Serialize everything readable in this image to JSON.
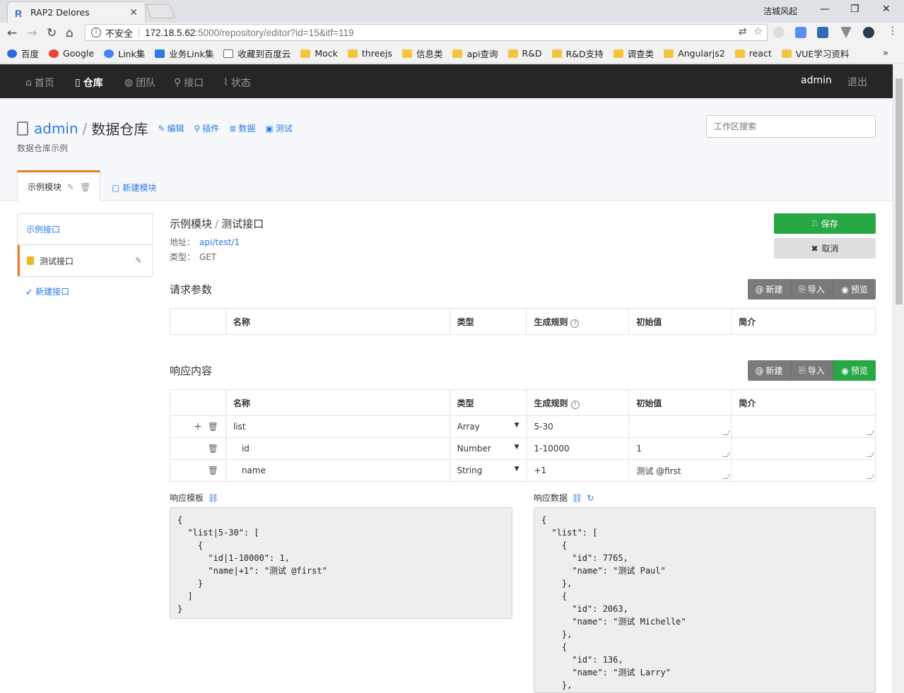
{
  "browser": {
    "tab_title": "RAP2 Delores",
    "window_user": "洁城风起",
    "insecure_label": "不安全",
    "url_host": "172.18.5.62",
    "url_path": ":5000/repository/editor?id=15&itf=119",
    "bookmarks": [
      "百度",
      "Google",
      "Link集",
      "业务Link集",
      "收藏到百度云",
      "Mock",
      "threejs",
      "信息类",
      "api查询",
      "R&D",
      "R&D支持",
      "调查类",
      "Angularjs2",
      "react",
      "VUE学习资料"
    ]
  },
  "appnav": {
    "items": [
      "首页",
      "仓库",
      "团队",
      "接口",
      "状态"
    ],
    "user": "admin",
    "logout": "退出"
  },
  "repo": {
    "owner": "admin",
    "name": "数据仓库",
    "actions": [
      "编辑",
      "插件",
      "数据",
      "测试"
    ],
    "description": "数据仓库示例",
    "search_placeholder": "工作区搜索",
    "module_tab": "示例模块",
    "new_module": "新建模块"
  },
  "sidebar": {
    "items": [
      "示例接口",
      "测试接口"
    ],
    "new_interface": "新建接口"
  },
  "interface": {
    "module": "示例模块",
    "name": "测试接口",
    "address_label": "地址：",
    "address": "api/test/1",
    "type_label": "类型：",
    "type": "GET",
    "save": "保存",
    "cancel": "取消"
  },
  "request": {
    "title": "请求参数",
    "buttons": [
      "新建",
      "导入",
      "预览"
    ]
  },
  "response": {
    "title": "响应内容",
    "buttons": [
      "新建",
      "导入",
      "预览"
    ]
  },
  "columns": [
    "名称",
    "类型",
    "生成规则",
    "初始值",
    "简介"
  ],
  "rows": [
    {
      "name": "list",
      "type": "Array",
      "rule": "5-30",
      "value": ""
    },
    {
      "name": "id",
      "type": "Number",
      "rule": "1-10000",
      "value": "1"
    },
    {
      "name": "name",
      "type": "String",
      "rule": "+1",
      "value": "测试 @first"
    }
  ],
  "template": {
    "label": "响应模板",
    "code": "{\n  \"list|5-30\": [\n    {\n      \"id|1-10000\": 1,\n      \"name|+1\": \"测试 @first\"\n    }\n  ]\n}"
  },
  "mockdata": {
    "label": "响应数据",
    "code": "{\n  \"list\": [\n    {\n      \"id\": 7765,\n      \"name\": \"测试 Paul\"\n    },\n    {\n      \"id\": 2063,\n      \"name\": \"测试 Michelle\"\n    },\n    {\n      \"id\": 136,\n      \"name\": \"测试 Larry\"\n    },\n    {"
  }
}
